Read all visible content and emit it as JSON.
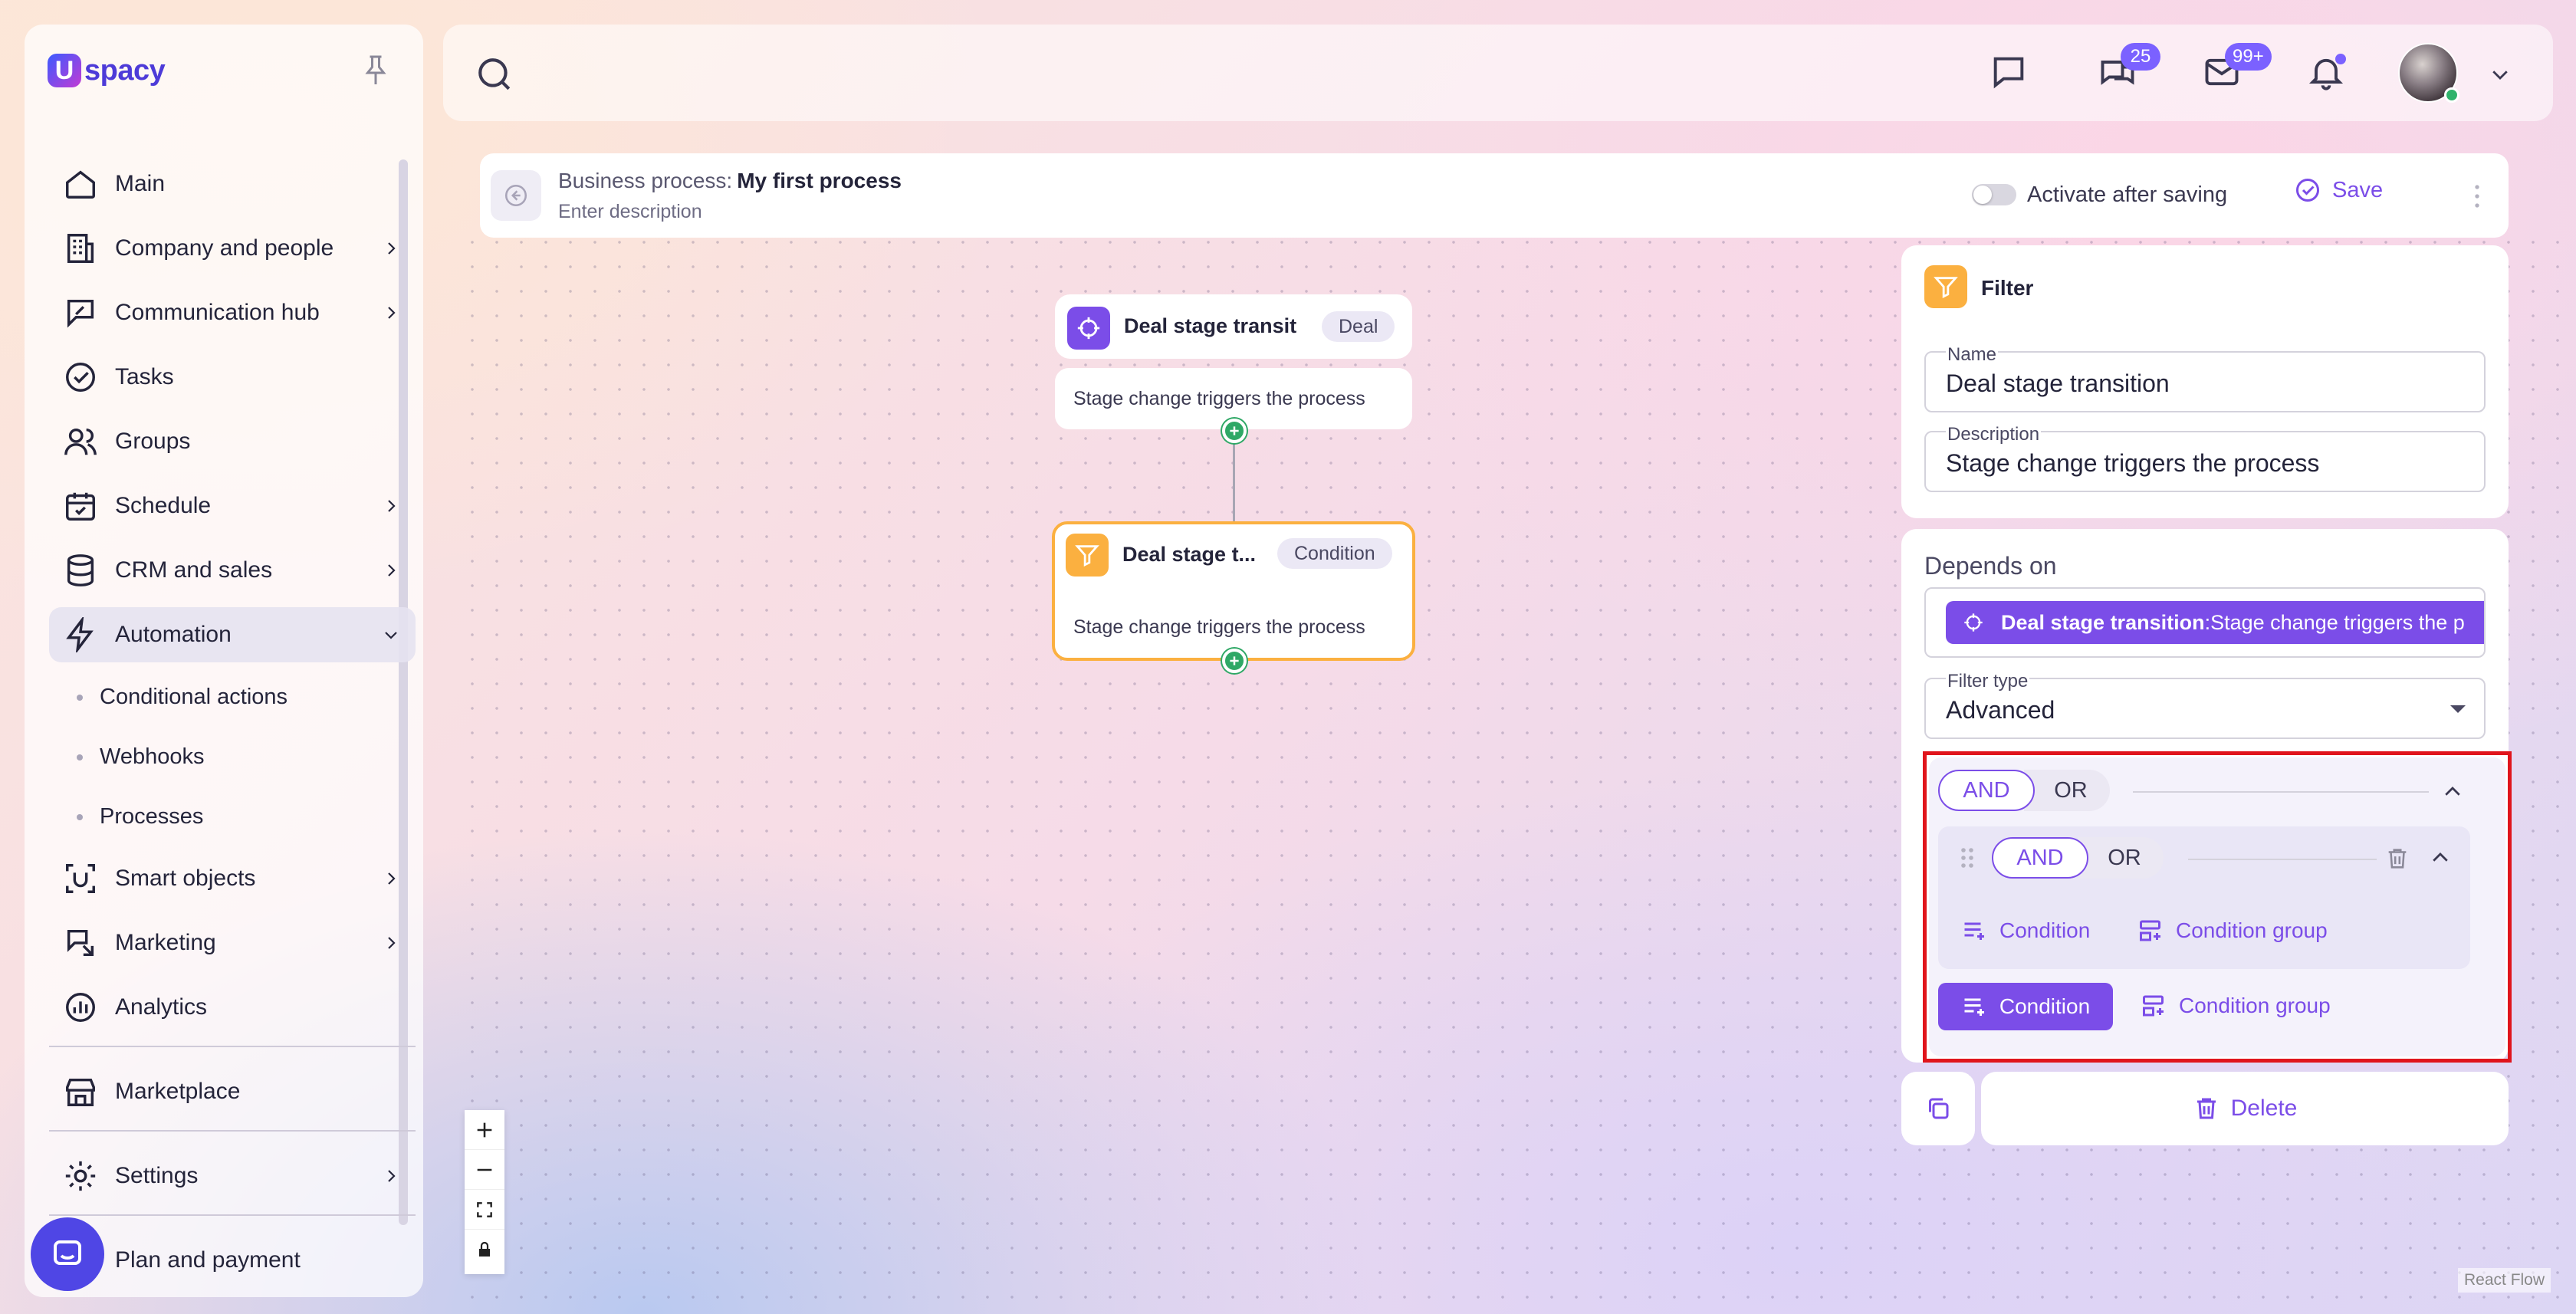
{
  "brand": {
    "logo_mark": "U",
    "logo_text": "spacy"
  },
  "sidebar": {
    "items": [
      {
        "label": "Main",
        "icon": "home-icon"
      },
      {
        "label": "Company and people",
        "icon": "building-icon"
      },
      {
        "label": "Communication hub",
        "icon": "chat-edit-icon"
      },
      {
        "label": "Tasks",
        "icon": "check-circle-icon"
      },
      {
        "label": "Groups",
        "icon": "users-icon"
      },
      {
        "label": "Schedule",
        "icon": "calendar-icon"
      },
      {
        "label": "CRM and sales",
        "icon": "database-icon"
      },
      {
        "label": "Automation",
        "icon": "lightning-icon"
      },
      {
        "label": "Smart objects",
        "icon": "smart-object-icon"
      },
      {
        "label": "Marketing",
        "icon": "marketing-icon"
      },
      {
        "label": "Analytics",
        "icon": "analytics-icon"
      },
      {
        "label": "Marketplace",
        "icon": "store-icon"
      },
      {
        "label": "Settings",
        "icon": "gear-icon"
      },
      {
        "label": "Plan and payment",
        "icon": "wallet-icon"
      }
    ],
    "automation_sub": [
      "Conditional actions",
      "Webhooks",
      "Processes"
    ]
  },
  "topbar": {
    "chat_badge": "25",
    "mail_badge": "99+"
  },
  "process": {
    "label": "Business process:",
    "name": "My first process",
    "description": "Enter description",
    "activate_label": "Activate after saving",
    "save_label": "Save"
  },
  "nodes": {
    "trigger": {
      "title": "Deal stage transitic",
      "tag": "Deal",
      "body": "Stage change triggers the process"
    },
    "filter": {
      "title": "Deal stage t...",
      "tag": "Condition",
      "body": "Stage change triggers the process"
    }
  },
  "panel": {
    "title": "Filter",
    "name_label": "Name",
    "name_value": "Deal stage transition",
    "desc_label": "Description",
    "desc_value": "Stage change triggers the process",
    "depends_label": "Depends on",
    "depends_chip_bold": "Deal stage transition",
    "depends_chip_rest": " :Stage change triggers the p",
    "filter_type_label": "Filter type",
    "filter_type_value": "Advanced",
    "outer_and": "AND",
    "outer_or": "OR",
    "inner_and": "AND",
    "inner_or": "OR",
    "condition": "Condition",
    "condition_group": "Condition group",
    "delete": "Delete"
  },
  "footer": {
    "react_flow": "React Flow"
  },
  "colors": {
    "accent": "#7b4de8",
    "highlight": "#e0151c",
    "filter_icon": "#fbb040",
    "handle": "#2fa866"
  }
}
